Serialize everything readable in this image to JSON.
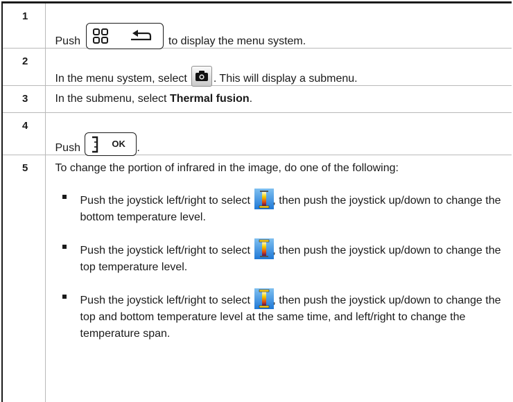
{
  "steps": [
    {
      "num": "1",
      "before": "Push",
      "after": "to display the menu system.",
      "icon": "menu-back-button-icon"
    },
    {
      "num": "2",
      "before": "In the menu system, select",
      "after": ". This will display a submenu.",
      "icon": "camera-mode-icon"
    },
    {
      "num": "3",
      "before": "In the submenu, select ",
      "bold": "Thermal fusion",
      "after": "."
    },
    {
      "num": "4",
      "before": "Push",
      "after": ".",
      "icon": "ok-button-icon",
      "key_label": "OK"
    },
    {
      "num": "5",
      "intro": "To change the portion of infrared in the image, do one of the following:"
    }
  ],
  "options": [
    {
      "before": "Push the joystick left/right to select",
      "after": ", then push the joystick up/down to change the bottom temperature level.",
      "icon": "bottom-level-scale-icon"
    },
    {
      "before": "Push the joystick left/right to select",
      "after": ", then push the joystick up/down to change the top temperature level.",
      "icon": "top-level-scale-icon"
    },
    {
      "before": "Push the joystick left/right to select",
      "after": ", then push the joystick up/down to change the top and bottom temperature level at the same time, and left/right to change the temperature span.",
      "icon": "span-scale-icon"
    }
  ],
  "colors": {
    "rule": "#1a1a1a",
    "divider": "#b9b9b9",
    "scale_blue": "#1f78d6",
    "scale_hot": "#e8b400"
  }
}
